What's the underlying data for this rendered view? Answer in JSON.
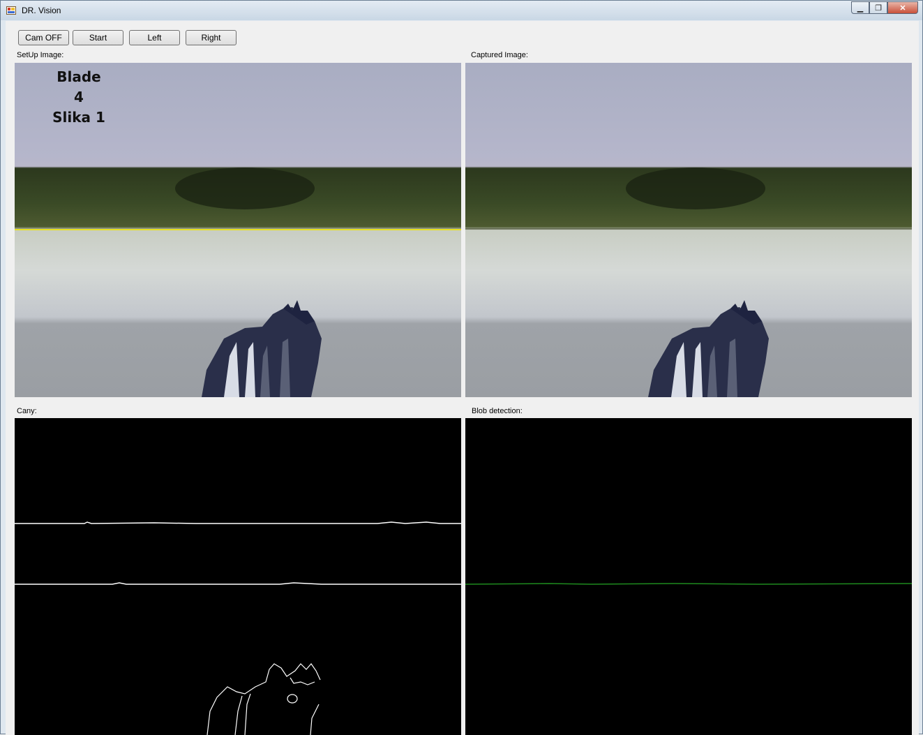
{
  "window": {
    "title": "DR. Vision",
    "icon": "app-icon"
  },
  "toolbar": {
    "cam_label": "Cam OFF",
    "start_label": "Start",
    "left_label": "Left",
    "right_label": "Right"
  },
  "panels": {
    "setup_label": "SetUp Image:",
    "captured_label": "Captured Image:",
    "canny_label": "Cany:",
    "blob_label": "Blob detection:"
  },
  "setup_overlay": {
    "line1": "Blade 4",
    "line2": "Slika 1"
  },
  "colors": {
    "edge_line": "#ffffff",
    "blob_line": "#1e8a1e",
    "setup_marker": "#e8e020"
  }
}
